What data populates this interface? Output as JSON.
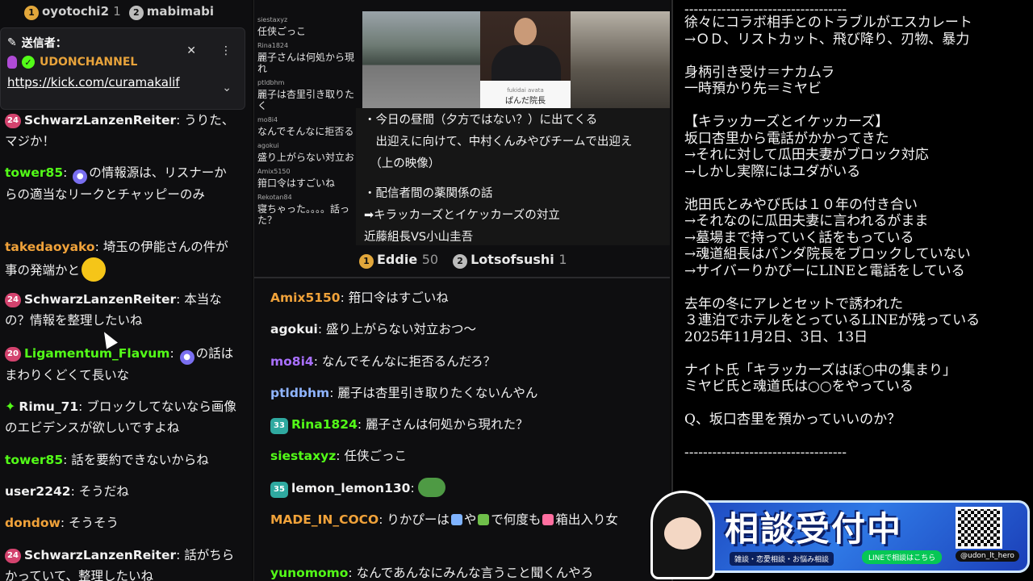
{
  "left": {
    "top_bar": {
      "rank1": "1",
      "user1": "oyotochi2",
      "count1": "1",
      "rank2": "2",
      "user2": "mabimabi"
    },
    "pinned": {
      "label": "送信者：",
      "sender": "UDONCHANNEL",
      "link": "https://kick.com/curamakalif"
    },
    "messages": [
      {
        "badge": "24",
        "user": "SchwarzLanzenReiter",
        "color": "#e8e8e8",
        "text": "うりた、マジか！"
      },
      {
        "badge": "",
        "user": "tower85",
        "color": "#53fc18",
        "text": "の情報源は、リスナーからの適当なリークとチャッピーのみ"
      },
      {
        "badge": "",
        "user": "takedaoyako",
        "color": "#f0a23a",
        "text": "埼玉の伊能さんの件が事の発端かと"
      },
      {
        "badge": "24",
        "user": "SchwarzLanzenReiter",
        "color": "#e8e8e8",
        "text": "本当なの？情報を整理したいね"
      },
      {
        "badge": "20",
        "user": "Ligamentum_Flavum",
        "color": "#53fc18",
        "text": "の話はまわりくどくて長いな"
      },
      {
        "badge": "star",
        "user": "Rimu_71",
        "color": "#e8e8e8",
        "text": "ブロックしてないなら画像のエビデンスが欲しいですよね"
      },
      {
        "badge": "",
        "user": "tower85",
        "color": "#53fc18",
        "text": "話を要約できないからね"
      },
      {
        "badge": "",
        "user": "user2242",
        "color": "#e8e8e8",
        "text": "そうだね"
      },
      {
        "badge": "",
        "user": "dondow",
        "color": "#f0a23a",
        "text": "そうそう"
      },
      {
        "badge": "24",
        "user": "SchwarzLanzenReiter",
        "color": "#e8e8e8",
        "text": "話がちらかっていて、整理したいね"
      }
    ]
  },
  "middle": {
    "mini_chat": [
      {
        "user": "siestaxyz",
        "text": "任侠ごっこ"
      },
      {
        "user": "Rina1824",
        "text": "麗子さんは何処から現れ"
      },
      {
        "user": "ptldbhm",
        "text": "麗子は杏里引き取りたく"
      },
      {
        "user": "mo8i4",
        "text": "なんでそんなに拒否る"
      },
      {
        "user": "agokui",
        "text": "盛り上がらない対立お"
      },
      {
        "user": "Amix5150",
        "text": "箝口令はすごいね"
      },
      {
        "user": "Rekotan84",
        "text": "寝ちゃった。。。。話った？"
      }
    ],
    "video": {
      "nameplate_small": "fukidai avata",
      "nameplate": "ぱんだ院長"
    },
    "notes": [
      "・今日の昼間（夕方ではない？）に出てくる",
      "　出迎えに向けて、中村くんみやびチームで出迎え",
      "　（上の映像）",
      "",
      "・配信者間の薬関係の話",
      "➡キラッカーズとイケッカーズの対立",
      "近藤組長VS小山圭吾"
    ],
    "leaderboard": [
      {
        "rank": "1",
        "user": "Eddie",
        "count": "50"
      },
      {
        "rank": "2",
        "user": "Lotsofsushi",
        "count": "1"
      }
    ],
    "messages": [
      {
        "badge": "",
        "user": "Amix5150",
        "color": "#f0a23a",
        "text": "箝口令はすごいね"
      },
      {
        "badge": "",
        "user": "agokui",
        "color": "#e8e8e8",
        "text": "盛り上がらない対立おつ〜"
      },
      {
        "badge": "",
        "user": "mo8i4",
        "color": "#a970ff",
        "text": "なんでそんなに拒否るんだろ？"
      },
      {
        "badge": "",
        "user": "ptldbhm",
        "color": "#8fb4ff",
        "text": "麗子は杏里引き取りたくないんやん"
      },
      {
        "badge": "33",
        "user": "Rina1824",
        "color": "#53fc18",
        "text": "麗子さんは何処から現れた？"
      },
      {
        "badge": "",
        "user": "siestaxyz",
        "color": "#53fc18",
        "text": "任侠ごっこ"
      },
      {
        "badge": "35",
        "user": "lemon_lemon130",
        "color": "#e8e8e8",
        "text": ""
      },
      {
        "badge": "",
        "user": "MADE_IN_COCO",
        "color": "#f0a23a",
        "text": "りかぴーは や で何度も 箱出入り女"
      },
      {
        "badge": "",
        "user": "yunomomo",
        "color": "#53fc18",
        "text": "なんであんなにみんな言うこと聞くんやろ"
      }
    ]
  },
  "right": {
    "lines": [
      "徐々にコラボ相手とのトラブルがエスカレート",
      "→ＯＤ、リストカット、飛び降り、刃物、暴力",
      "",
      "身柄引き受け＝ナカムラ",
      "一時預かり先＝ミヤビ",
      "",
      "【キラッカーズとイケッカーズ】",
      "坂口杏里から電話がかかってきた",
      "→それに対して瓜田夫妻がブロック対応",
      "→しかし実際にはユダがいる",
      "",
      "池田氏とみやび氏は１０年の付き合い",
      "→それなのに瓜田夫妻に言われるがまま",
      "→墓場まで持っていく話をもっている",
      "→魂道組長はパンダ院長をブロックしていない",
      "→サイバーりかぴーにLINEと電話をしている",
      "",
      "去年の冬にアレとセットで誘われた",
      "３連泊でホテルをとっているLINEが残っている",
      "2025年11月2日、3日、13日",
      "",
      "ナイト氏「キラッカーズはぼ○中の集まり」",
      "ミヤビ氏と魂道氏は○○をやっている",
      "",
      "Q、坂口杏里を預かっていいのか？",
      "",
      "-----------------------------------"
    ],
    "separator_top": "-----------------------------------"
  },
  "banner": {
    "title": "相談受付中",
    "subtitle": "雑談・恋愛相談・お悩み相談",
    "line_label": "LINEで相談はこちら",
    "x_handle": "@udon_lt_hero"
  }
}
